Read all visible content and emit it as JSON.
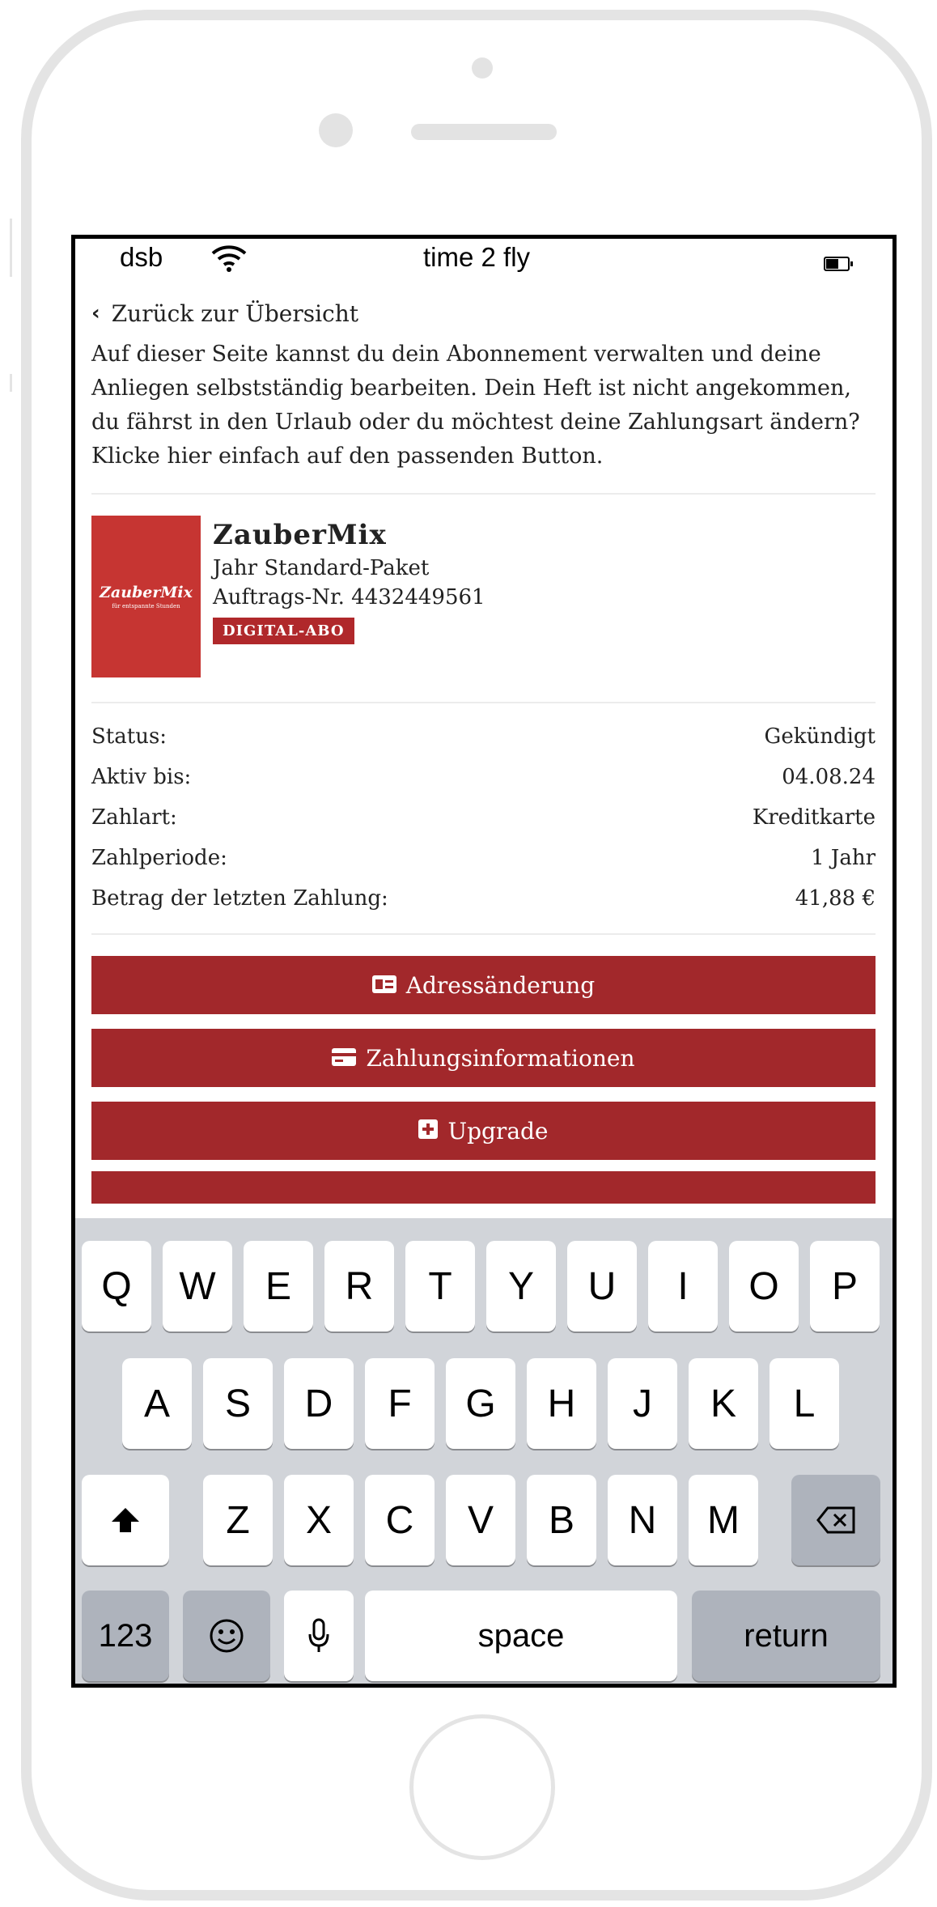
{
  "status_bar": {
    "carrier": "dsb",
    "time": "time 2 fly"
  },
  "back_link": "Zurück zur Übersicht",
  "intro_text": "Auf dieser Seite kannst du dein Abonnement verwalten und deine Anliegen selbstständig bearbeiten. Dein Heft ist nicht angekommen, du fährst in den Urlaub oder du möchtest deine Zahlungsart ändern? Klicke hier einfach auf den passenden Button.",
  "product": {
    "logo_text": "ZauberMix",
    "logo_subtext": "für entspannte Stunden",
    "name": "ZauberMix",
    "package": "Jahr Standard-Paket",
    "order_no": "Auftrags-Nr. 4432449561",
    "badge": "DIGITAL-ABO"
  },
  "details": [
    {
      "label": "Status:",
      "value": "Gekündigt"
    },
    {
      "label": "Aktiv bis:",
      "value": "04.08.24"
    },
    {
      "label": "Zahlart:",
      "value": "Kreditkarte"
    },
    {
      "label": "Zahlperiode:",
      "value": "1 Jahr"
    },
    {
      "label": "Betrag der letzten Zahlung:",
      "value": "41,88 €"
    }
  ],
  "buttons": {
    "address": "Adressänderung",
    "payment": "Zahlungsinformationen",
    "upgrade": "Upgrade"
  },
  "keyboard": {
    "row1": [
      "Q",
      "W",
      "E",
      "R",
      "T",
      "Y",
      "U",
      "I",
      "O",
      "P"
    ],
    "row2": [
      "A",
      "S",
      "D",
      "F",
      "G",
      "H",
      "J",
      "K",
      "L"
    ],
    "row3": [
      "Z",
      "X",
      "C",
      "V",
      "B",
      "N",
      "M"
    ],
    "numbers": "123",
    "space": "space",
    "return": "return"
  },
  "colors": {
    "brand_red": "#a2282b",
    "logo_red": "#c63532"
  }
}
